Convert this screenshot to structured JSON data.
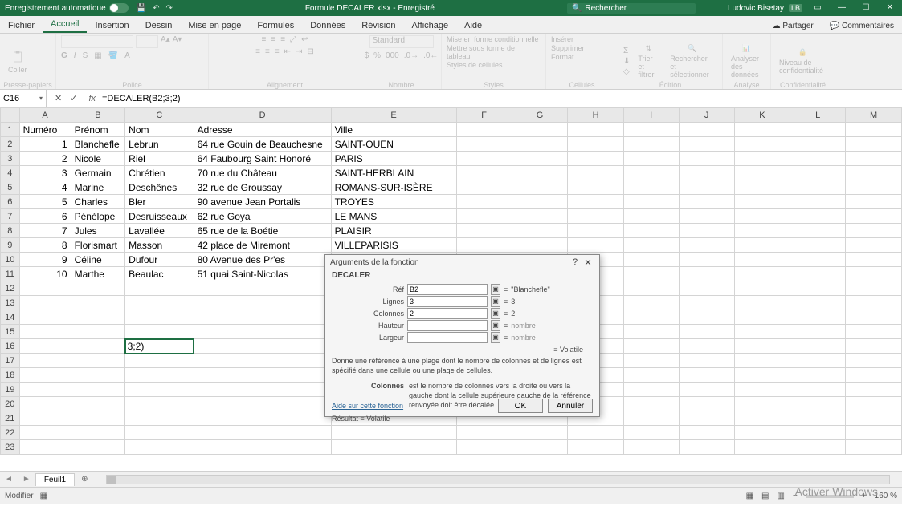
{
  "titlebar": {
    "autosave": "Enregistrement automatique",
    "doc_title": "Formule DECALER.xlsx - Enregistré",
    "search_placeholder": "Rechercher",
    "user_name": "Ludovic Bisetay",
    "user_initials": "LB"
  },
  "menu": {
    "tabs": [
      "Fichier",
      "Accueil",
      "Insertion",
      "Dessin",
      "Mise en page",
      "Formules",
      "Données",
      "Révision",
      "Affichage",
      "Aide"
    ],
    "active": "Accueil",
    "share": "Partager",
    "comments": "Commentaires"
  },
  "ribbon": {
    "groups": [
      "Presse-papiers",
      "Police",
      "Alignement",
      "Nombre",
      "Styles",
      "Cellules",
      "Édition",
      "Analyse",
      "Confidentialité"
    ],
    "clipboard_paste": "Coller",
    "number_format": "Standard",
    "styles": {
      "cond": "Mise en forme conditionnelle",
      "table": "Mettre sous forme de tableau",
      "cell": "Styles de cellules"
    },
    "cells": {
      "insert": "Insérer",
      "delete": "Supprimer",
      "format": "Format"
    },
    "editing": {
      "sort": "Trier et filtrer",
      "find": "Rechercher et sélectionner"
    },
    "analysis": "Analyser des données",
    "confidentiality": "Niveau de confidentialité"
  },
  "formula_bar": {
    "cell_ref": "C16",
    "formula": "=DECALER(B2;3;2)"
  },
  "grid": {
    "columns": [
      "A",
      "B",
      "C",
      "D",
      "E",
      "F",
      "G",
      "H",
      "I",
      "J",
      "K",
      "L",
      "M"
    ],
    "headers": [
      "Numéro",
      "Prénom",
      "Nom",
      "Adresse",
      "Ville"
    ],
    "rows": [
      {
        "n": "1",
        "pr": "Blanchefle",
        "nom": "Lebrun",
        "adr": "64 rue Gouin de Beauchesne",
        "ville": "SAINT-OUEN"
      },
      {
        "n": "2",
        "pr": "Nicole",
        "nom": "Riel",
        "adr": "64 Faubourg Saint Honoré",
        "ville": "PARIS"
      },
      {
        "n": "3",
        "pr": "Germain",
        "nom": "Chrétien",
        "adr": "70 rue du Château",
        "ville": "SAINT-HERBLAIN"
      },
      {
        "n": "4",
        "pr": "Marine",
        "nom": "Deschênes",
        "adr": "32 rue de Groussay",
        "ville": "ROMANS-SUR-ISÈRE"
      },
      {
        "n": "5",
        "pr": "Charles",
        "nom": "Bler",
        "adr": "90 avenue Jean Portalis",
        "ville": "TROYES"
      },
      {
        "n": "6",
        "pr": "Pénélope",
        "nom": "Desruisseaux",
        "adr": "62 rue Goya",
        "ville": "LE MANS"
      },
      {
        "n": "7",
        "pr": "Jules",
        "nom": "Lavallée",
        "adr": "65 rue de la Boétie",
        "ville": "PLAISIR"
      },
      {
        "n": "8",
        "pr": "Florismart",
        "nom": "Masson",
        "adr": "42 place de Miremont",
        "ville": "VILLEPARISIS"
      },
      {
        "n": "9",
        "pr": "Céline",
        "nom": "Dufour",
        "adr": "80 Avenue des Pr'es",
        "ville": ""
      },
      {
        "n": "10",
        "pr": "Marthe",
        "nom": "Beaulac",
        "adr": "51 quai Saint-Nicolas",
        "ville": ""
      }
    ],
    "editing_cell_value": "3;2)",
    "row_count": 23,
    "sheet_name": "Feuil1"
  },
  "dialog": {
    "title": "Arguments de la fonction",
    "func_name": "DECALER",
    "args": [
      {
        "label": "Réf",
        "value": "B2",
        "result": "\"Blanchefle\""
      },
      {
        "label": "Lignes",
        "value": "3",
        "result": "3"
      },
      {
        "label": "Colonnes",
        "value": "2",
        "result": "2"
      },
      {
        "label": "Hauteur",
        "value": "",
        "result": "nombre"
      },
      {
        "label": "Largeur",
        "value": "",
        "result": "nombre"
      }
    ],
    "volatile_eq": "= Volatile",
    "desc_main": "Donne une référence à une plage dont le nombre de colonnes et de lignes est spécifié dans une cellule ou une plage de cellules.",
    "desc_arg_label": "Colonnes",
    "desc_arg_text": "est le nombre de colonnes vers la droite ou vers la gauche dont la cellule supérieure gauche de la référence renvoyée doit être décalée.",
    "result_label": "Résultat =",
    "result_value": "Volatile",
    "help_link": "Aide sur cette fonction",
    "ok": "OK",
    "cancel": "Annuler"
  },
  "status": {
    "mode": "Modifier",
    "watermark": "Activer Windows",
    "zoom": "160 %"
  }
}
